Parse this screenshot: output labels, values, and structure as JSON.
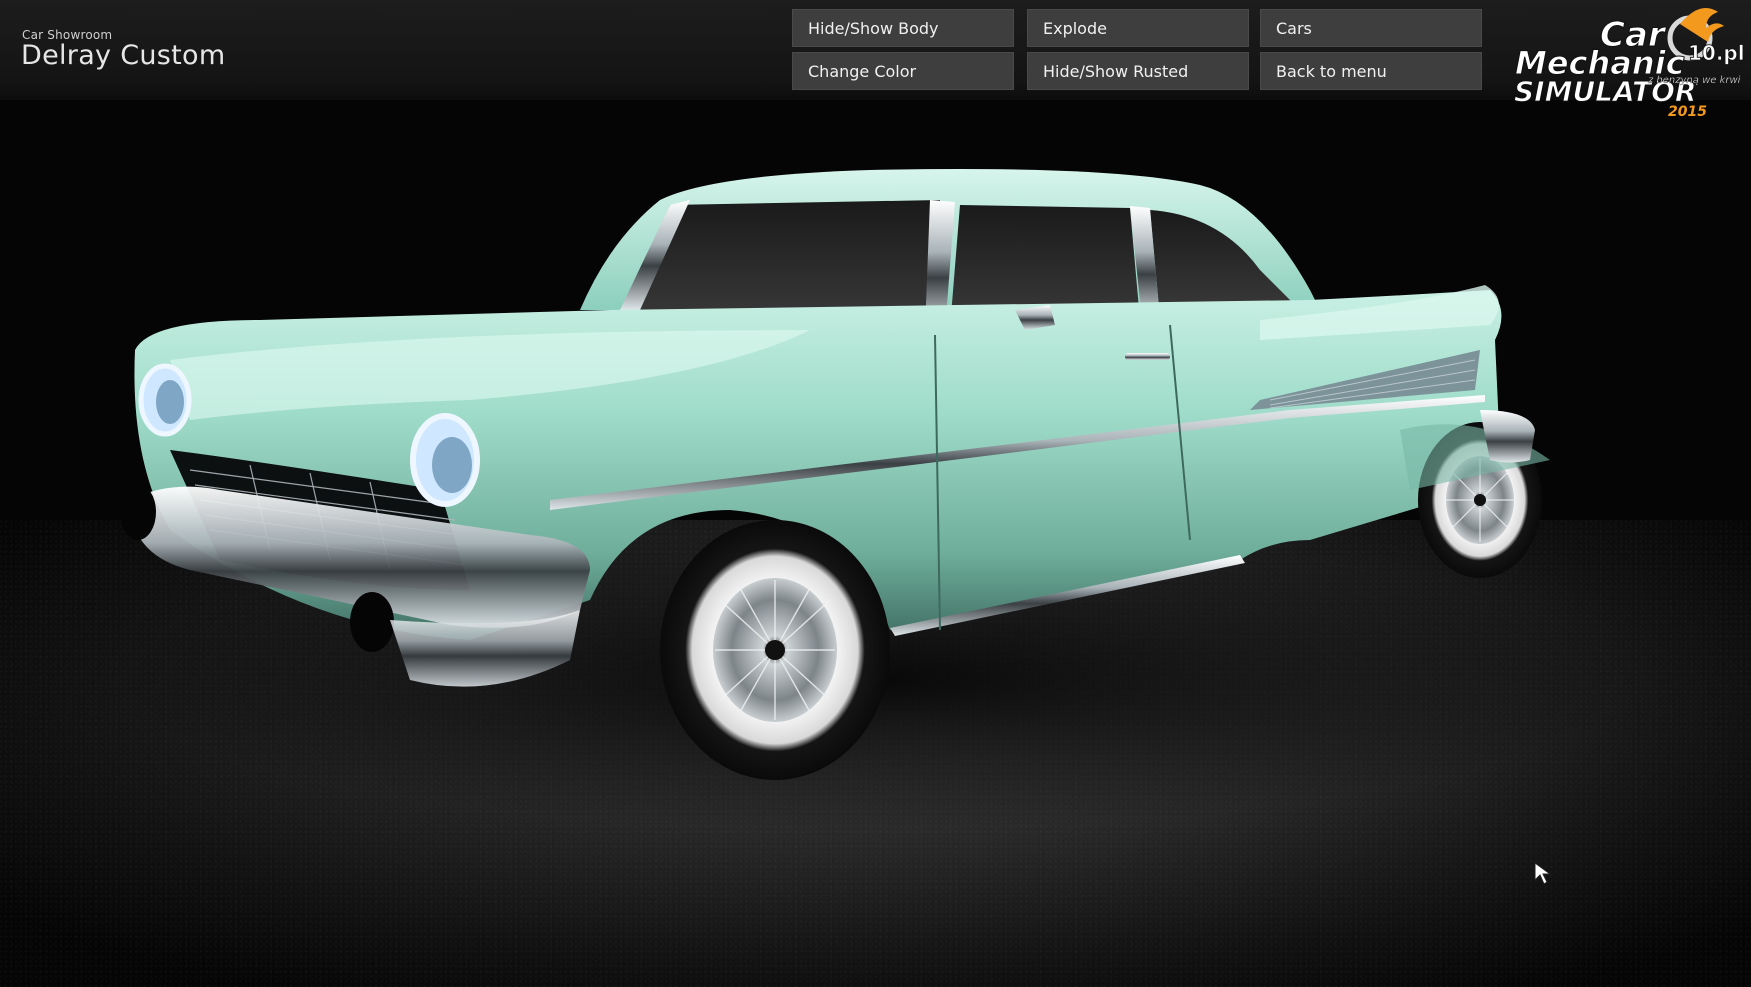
{
  "header": {
    "subtitle": "Car Showroom",
    "title": "Delray Custom"
  },
  "buttons": {
    "hide_show_body": "Hide/Show Body",
    "explode": "Explode",
    "cars": "Cars",
    "change_color": "Change Color",
    "hide_show_rusted": "Hide/Show Rusted",
    "back_to_menu": "Back to menu"
  },
  "logo": {
    "line1": "Car",
    "line2": "Mechanic",
    "line3": "SIMULATOR",
    "year": "2015",
    "badge": "10.pl",
    "tagline": "z benzyną we krwi"
  },
  "colors": {
    "car_body": "#8fd1bd",
    "button_bg": "#3e3e3e",
    "logo_accent": "#f39a1e"
  },
  "car": {
    "icon": "car-3d-model"
  },
  "cursor": {
    "icon": "pointer-cursor-icon"
  }
}
